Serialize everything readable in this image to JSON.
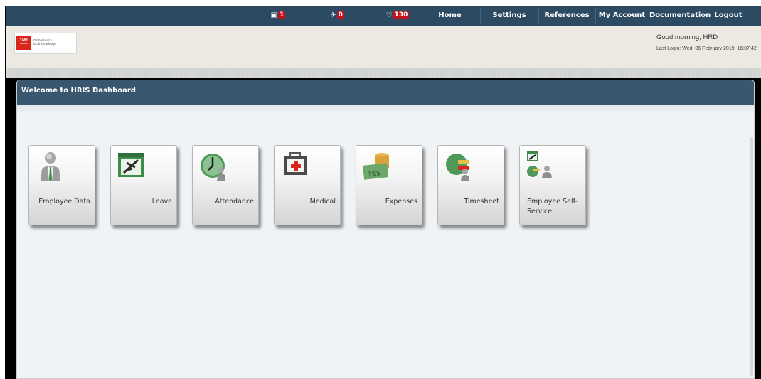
{
  "nav": {
    "tickets_count": "1",
    "flights_count": "0",
    "notifications_count": "130",
    "home": "Home",
    "settings": "Settings",
    "references": "References",
    "my_account": "My Account",
    "documentation": "Documentation",
    "logout": "Logout",
    "icons": [
      "ticket-icon",
      "airplane-icon",
      "bell-icon"
    ]
  },
  "header": {
    "logo_mark": "TMF",
    "logo_sub": "GROUP",
    "logo_tagline_1": "Global reach",
    "logo_tagline_2": "local knowledge",
    "greeting": "Good morning, HRD",
    "last_login": "Last Login: Wed, 06 February 2019, 16:07:42"
  },
  "panel": {
    "title": "Welcome to HRIS Dashboard"
  },
  "tiles": [
    {
      "label": "Employee Data",
      "icon": "person-icon"
    },
    {
      "label": "Leave",
      "icon": "leave-plane-icon"
    },
    {
      "label": "Attendance",
      "icon": "clock-person-icon"
    },
    {
      "label": "Medical",
      "icon": "medical-kit-icon"
    },
    {
      "label": "Expenses",
      "icon": "money-icon"
    },
    {
      "label": "Timesheet",
      "icon": "timesheet-icon"
    },
    {
      "label": "Employee Self-Service",
      "icon": "self-service-icon"
    }
  ],
  "colors": {
    "nav_bg": "#2d4a63",
    "badge": "#c4121d",
    "panel_head": "#3a5770",
    "brand_red": "#d9261c"
  }
}
